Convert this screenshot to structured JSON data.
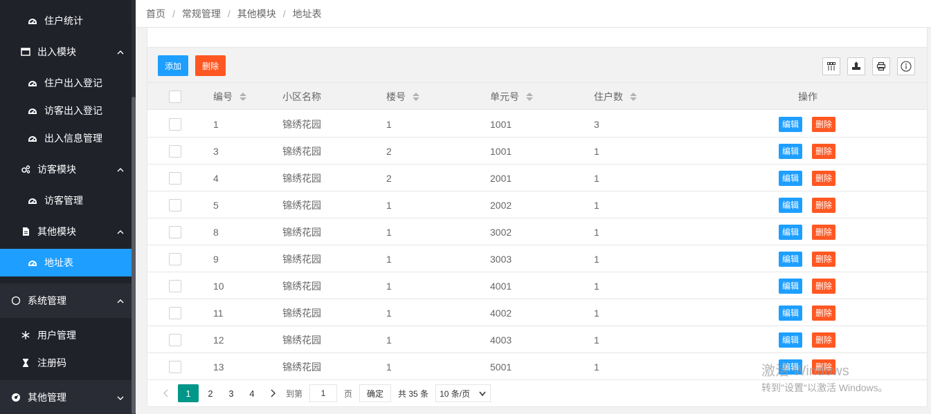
{
  "sidebar": {
    "items": [
      {
        "label": "住户统计",
        "icon": "dashboard-icon",
        "kind": "sub"
      },
      {
        "label": "出入模块",
        "icon": "window-icon",
        "kind": "group"
      },
      {
        "label": "住户出入登记",
        "icon": "dashboard-icon",
        "kind": "sub"
      },
      {
        "label": "访客出入登记",
        "icon": "dashboard-icon",
        "kind": "sub"
      },
      {
        "label": "出入信息管理",
        "icon": "dashboard-icon",
        "kind": "sub"
      },
      {
        "label": "访客模块",
        "icon": "gears-icon",
        "kind": "group"
      },
      {
        "label": "访客管理",
        "icon": "dashboard-icon",
        "kind": "sub"
      },
      {
        "label": "其他模块",
        "icon": "file-icon",
        "kind": "group"
      },
      {
        "label": "地址表",
        "icon": "dashboard-icon",
        "kind": "sub"
      },
      {
        "label": "系统管理",
        "icon": "circle-icon",
        "kind": "top"
      },
      {
        "label": "用户管理",
        "icon": "snowflake-icon",
        "kind": "group"
      },
      {
        "label": "注册码",
        "icon": "hourglass-icon",
        "kind": "group"
      },
      {
        "label": "其他管理",
        "icon": "gauge-icon",
        "kind": "top"
      }
    ],
    "active_index": 8,
    "colors": {
      "bg": "#20222a",
      "active": "#1e9fff"
    }
  },
  "breadcrumb": [
    "首页",
    "常规管理",
    "其他模块",
    "地址表"
  ],
  "toolbar": {
    "add_label": "添加",
    "delete_label": "删除"
  },
  "table": {
    "headers": [
      "编号",
      "小区名称",
      "楼号",
      "单元号",
      "住户数",
      "操作"
    ],
    "rows": [
      [
        "1",
        "锦绣花园",
        "1",
        "1001",
        "3"
      ],
      [
        "3",
        "锦绣花园",
        "2",
        "1001",
        "1"
      ],
      [
        "4",
        "锦绣花园",
        "2",
        "2001",
        "1"
      ],
      [
        "5",
        "锦绣花园",
        "1",
        "2002",
        "1"
      ],
      [
        "8",
        "锦绣花园",
        "1",
        "3002",
        "1"
      ],
      [
        "9",
        "锦绣花园",
        "1",
        "3003",
        "1"
      ],
      [
        "10",
        "锦绣花园",
        "1",
        "4001",
        "1"
      ],
      [
        "11",
        "锦绣花园",
        "1",
        "4002",
        "1"
      ],
      [
        "12",
        "锦绣花园",
        "1",
        "4003",
        "1"
      ],
      [
        "13",
        "锦绣花园",
        "1",
        "5001",
        "1"
      ]
    ],
    "row_edit_label": "编辑",
    "row_delete_label": "删除"
  },
  "pager": {
    "pages": [
      "1",
      "2",
      "3",
      "4"
    ],
    "current": "1",
    "goto_label": "到第",
    "goto_value": "1",
    "page_unit": "页",
    "confirm_label": "确定",
    "total_label": "共 35 条",
    "page_size": "10 条/页"
  },
  "watermark": {
    "line1": "激活 Windows",
    "line2": "转到\"设置\"以激活 Windows。"
  }
}
